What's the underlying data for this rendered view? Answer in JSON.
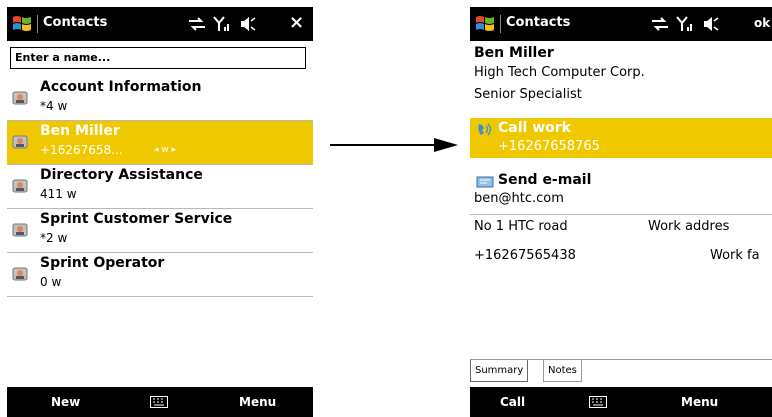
{
  "left": {
    "title": "Contacts",
    "search_placeholder": "Enter a name...",
    "contacts": [
      {
        "name": "Account Information",
        "sub": "*4  w",
        "selected": false
      },
      {
        "name": "Ben Miller",
        "sub": "+16267658...",
        "selected": true,
        "arrows": "◂ w ▸"
      },
      {
        "name": "Directory Assistance",
        "sub": "411  w",
        "selected": false
      },
      {
        "name": "Sprint Customer Service",
        "sub": "*2  w",
        "selected": false
      },
      {
        "name": "Sprint Operator",
        "sub": "0  w",
        "selected": false
      }
    ],
    "softkeys": {
      "left": "New",
      "right": "Menu"
    },
    "close_glyph": "×"
  },
  "right": {
    "title": "Contacts",
    "status_text": "ok",
    "name": "Ben Miller",
    "company": "High Tech Computer Corp.",
    "job_title": "Senior Specialist",
    "call": {
      "title": "Call work",
      "number": "+16267658765"
    },
    "email": {
      "title": "Send e-mail",
      "address": "ben@htc.com"
    },
    "address": {
      "value": "No 1 HTC road",
      "label": "Work addres"
    },
    "fax": {
      "value": "+16267565438",
      "label": "Work fa"
    },
    "tabs": [
      "Summary",
      "Notes"
    ],
    "softkeys": {
      "left": "Call",
      "right": "Menu"
    }
  },
  "colors": {
    "highlight": "#f0c800",
    "bar": "#000000"
  }
}
